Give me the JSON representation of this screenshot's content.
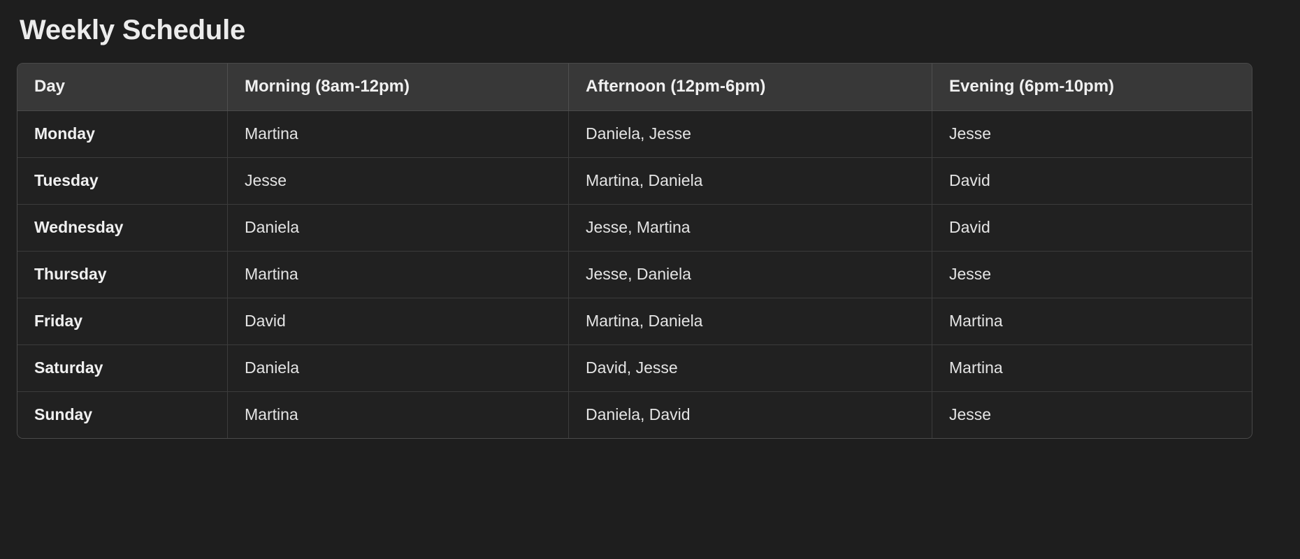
{
  "page": {
    "title": "Weekly Schedule",
    "background_color": "#1e1e1e",
    "text_color": "#e8e8e8"
  },
  "table": {
    "name": "weekly-schedule-table",
    "header_background": "#383838",
    "row_background": "#212121",
    "border_color": "#4a4a4a",
    "columns": [
      {
        "key": "day",
        "label": "Day"
      },
      {
        "key": "morning",
        "label": "Morning (8am-12pm)"
      },
      {
        "key": "afternoon",
        "label": "Afternoon (12pm-6pm)"
      },
      {
        "key": "evening",
        "label": "Evening (6pm-10pm)"
      }
    ],
    "rows": [
      {
        "day": "Monday",
        "morning": "Martina",
        "afternoon": "Daniela, Jesse",
        "evening": "Jesse"
      },
      {
        "day": "Tuesday",
        "morning": "Jesse",
        "afternoon": "Martina, Daniela",
        "evening": "David"
      },
      {
        "day": "Wednesday",
        "morning": "Daniela",
        "afternoon": "Jesse, Martina",
        "evening": "David"
      },
      {
        "day": "Thursday",
        "morning": "Martina",
        "afternoon": "Jesse, Daniela",
        "evening": "Jesse"
      },
      {
        "day": "Friday",
        "morning": "David",
        "afternoon": "Martina, Daniela",
        "evening": "Martina"
      },
      {
        "day": "Saturday",
        "morning": "Daniela",
        "afternoon": "David, Jesse",
        "evening": "Martina"
      },
      {
        "day": "Sunday",
        "morning": "Martina",
        "afternoon": "Daniela, David",
        "evening": "Jesse"
      }
    ]
  }
}
